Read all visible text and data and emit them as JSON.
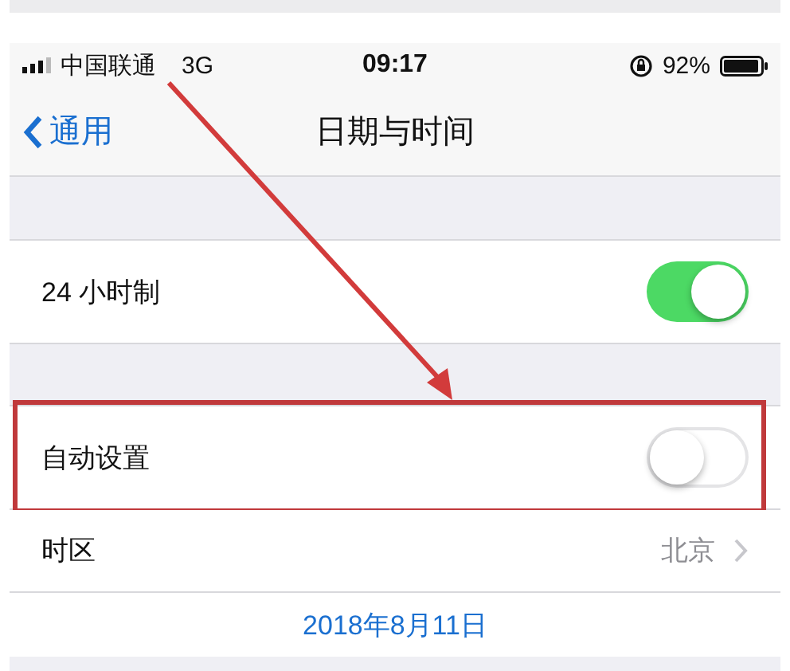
{
  "status_bar": {
    "carrier": "中国联通",
    "network": "3G",
    "time": "09:17",
    "battery": "92%"
  },
  "nav": {
    "back": "通用",
    "title": "日期与时间"
  },
  "rows": [
    {
      "kind": "toggle",
      "label": "24 小时制",
      "on": true,
      "highlighted": false
    },
    {
      "kind": "toggle",
      "label": "自动设置",
      "on": false,
      "highlighted": true
    },
    {
      "kind": "detail",
      "label": "时区",
      "value": "北京",
      "highlighted": false
    }
  ],
  "date": "2018年8月11日"
}
